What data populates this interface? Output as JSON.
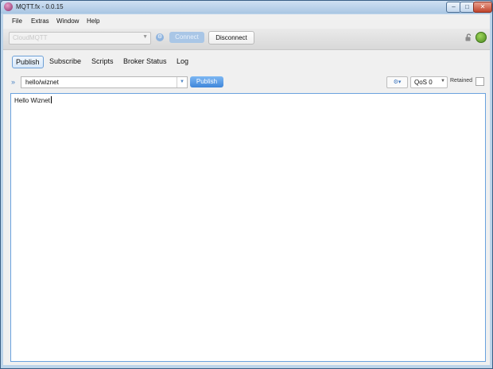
{
  "window": {
    "title": "MQTT.fx - 0.0.15",
    "controls": {
      "minimize": "–",
      "maximize": "□",
      "close": "✕"
    }
  },
  "menu": [
    "File",
    "Extras",
    "Window",
    "Help"
  ],
  "toolbar": {
    "profile": "CloudMQTT",
    "connect_label": "Connect",
    "disconnect_label": "Disconnect"
  },
  "tabs": [
    "Publish",
    "Subscribe",
    "Scripts",
    "Broker Status",
    "Log"
  ],
  "publish": {
    "topic": "hello/wiznet",
    "publish_label": "Publish",
    "qos": "QoS 0",
    "retained_label": "Retained",
    "retained_checked": false,
    "payload": "Hello Wiznet"
  },
  "icons": {
    "expand": "»",
    "dropdown": "▼",
    "options": "⚙▾",
    "gear": "⚙"
  },
  "colors": {
    "accent": "#3f86da",
    "status": "#5a9e2a"
  }
}
